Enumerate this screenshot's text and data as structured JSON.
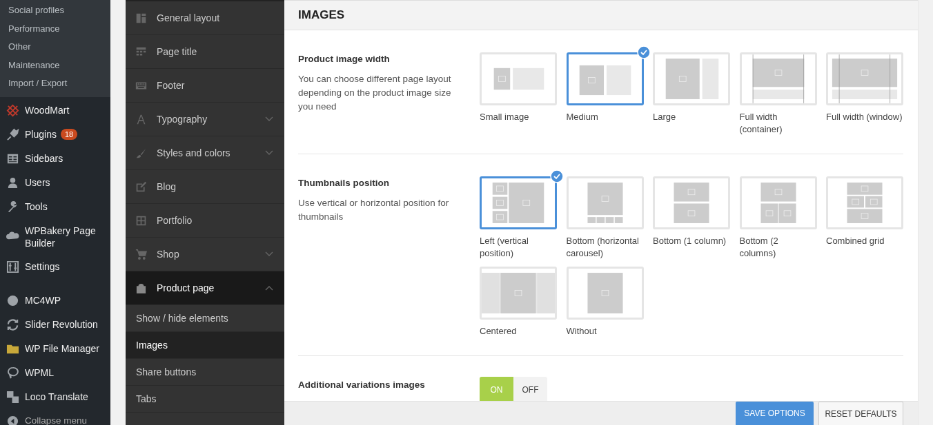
{
  "admin_menu": {
    "submenu": [
      {
        "label": "Social profiles"
      },
      {
        "label": "Performance"
      },
      {
        "label": "Other"
      },
      {
        "label": "Maintenance"
      },
      {
        "label": "Import / Export"
      }
    ],
    "groups": [
      [
        {
          "label": "WoodMart"
        },
        {
          "label": "Plugins",
          "badge": "18"
        },
        {
          "label": "Sidebars"
        },
        {
          "label": "Users"
        },
        {
          "label": "Tools"
        },
        {
          "label": "WPBakery Page Builder"
        },
        {
          "label": "Settings"
        }
      ],
      [
        {
          "label": "MC4WP"
        },
        {
          "label": "Slider Revolution"
        },
        {
          "label": "WP File Manager"
        },
        {
          "label": "WPML"
        },
        {
          "label": "Loco Translate"
        },
        {
          "label": "Collapse menu"
        }
      ]
    ]
  },
  "options_nav": [
    {
      "label": "General layout",
      "kind": "link",
      "selected": false
    },
    {
      "label": "Page title",
      "kind": "link",
      "selected": false
    },
    {
      "label": "Footer",
      "kind": "link",
      "selected": false
    },
    {
      "label": "Typography",
      "kind": "group",
      "selected": false,
      "expanded": false
    },
    {
      "label": "Styles and colors",
      "kind": "group",
      "selected": false,
      "expanded": false
    },
    {
      "label": "Blog",
      "kind": "link",
      "selected": false
    },
    {
      "label": "Portfolio",
      "kind": "link",
      "selected": false
    },
    {
      "label": "Shop",
      "kind": "group",
      "selected": false,
      "expanded": false
    },
    {
      "label": "Product page",
      "kind": "group",
      "selected": true,
      "expanded": true,
      "children": [
        {
          "label": "Show / hide elements",
          "selected": false
        },
        {
          "label": "Images",
          "selected": true
        },
        {
          "label": "Share buttons",
          "selected": false
        },
        {
          "label": "Tabs",
          "selected": false
        }
      ]
    }
  ],
  "page": {
    "title": "IMAGES",
    "sections": [
      {
        "kind": "image_select",
        "title": "Product image width",
        "description": "You can choose different page layout depending on the product image size you need",
        "options": [
          {
            "label": "Small image",
            "kind": "small",
            "selected": false
          },
          {
            "label": "Medium",
            "kind": "medium",
            "selected": true
          },
          {
            "label": "Large",
            "kind": "large",
            "selected": false
          },
          {
            "label": "Full width (container)",
            "kind": "full_container",
            "selected": false
          },
          {
            "label": "Full width (window)",
            "kind": "full_window",
            "selected": false
          }
        ]
      },
      {
        "kind": "image_select",
        "title": "Thumbnails position",
        "description": "Use vertical or horizontal position for thumbnails",
        "options": [
          {
            "label": "Left (vertical position)",
            "kind": "left",
            "selected": true
          },
          {
            "label": "Bottom (horizontal carousel)",
            "kind": "bottom_carousel",
            "selected": false
          },
          {
            "label": "Bottom (1 column)",
            "kind": "bottom_1",
            "selected": false
          },
          {
            "label": "Bottom (2 columns)",
            "kind": "bottom_2",
            "selected": false
          },
          {
            "label": "Combined grid",
            "kind": "combined",
            "selected": false
          },
          {
            "label": "Centered",
            "kind": "centered",
            "selected": false
          },
          {
            "label": "Without",
            "kind": "without",
            "selected": false
          }
        ]
      },
      {
        "kind": "switch",
        "title": "Additional variations images",
        "on": true,
        "on_label": "ON",
        "off_label": "OFF"
      }
    ]
  },
  "footer": {
    "save": "SAVE OPTIONS",
    "reset": "RESET DEFAULTS"
  }
}
